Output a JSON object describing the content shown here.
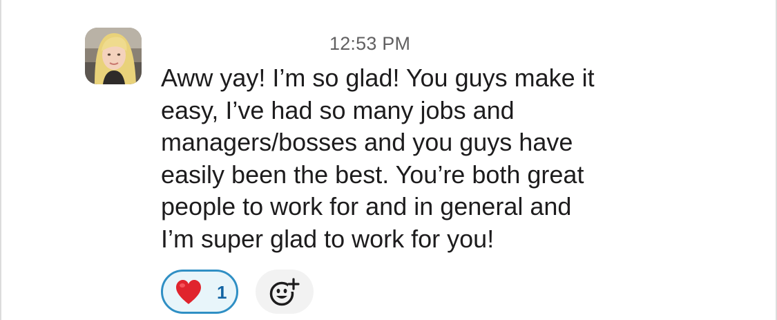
{
  "message": {
    "timestamp": "12:53 PM",
    "lines": [
      "Aww yay! I’m so glad! You guys make it",
      "easy, I’ve had so many jobs and",
      "managers/bosses and you guys have",
      "easily been the best. You’re both great",
      "people to work for and in general and",
      "I’m super glad to work for you!"
    ],
    "avatar_icon": "user-avatar-photo"
  },
  "reactions": [
    {
      "emoji": "heart-icon",
      "count": "1",
      "selected": true,
      "color": "#e0242d"
    }
  ],
  "add_reaction": {
    "icon": "add-emoji-icon"
  },
  "colors": {
    "text": "#1d1c1d",
    "timestamp": "#616061",
    "reaction_border": "#2f8fc4",
    "reaction_bg": "#e8f5fa",
    "reaction_count": "#1264a3",
    "add_reaction_bg": "#f2f2f2"
  }
}
